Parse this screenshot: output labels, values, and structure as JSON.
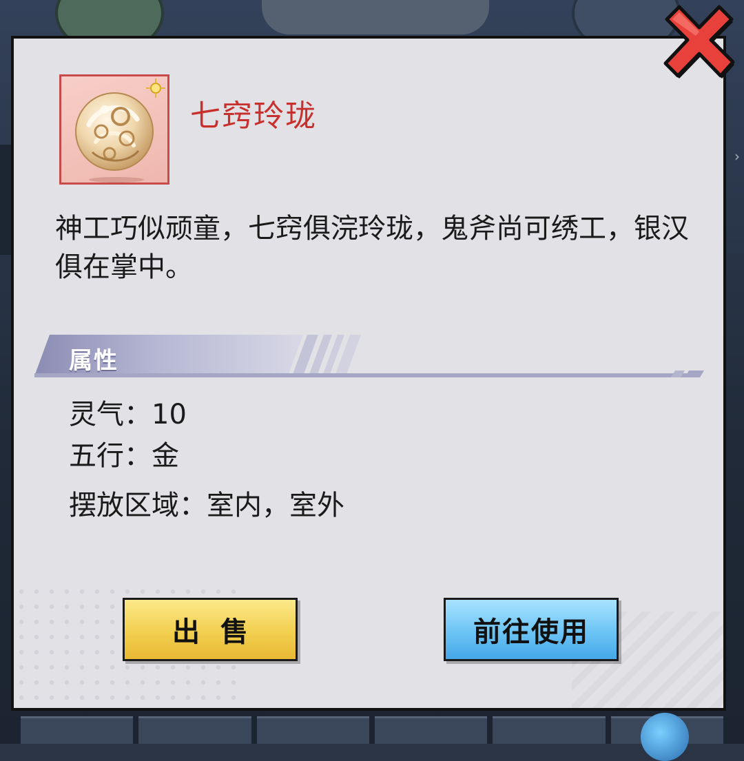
{
  "item": {
    "name": "七窍玲珑",
    "description": "神工巧似顽童，七窍俱浣玲珑，鬼斧尚可绣工，银汉俱在掌中。",
    "frame_color": "#c84a4a",
    "icon": "jade-sphere-icon"
  },
  "attributes": {
    "header": "属性",
    "rows": [
      {
        "label": "灵气",
        "separator": "：",
        "value": "10"
      },
      {
        "label": "五行",
        "separator": "：",
        "value": "金"
      },
      {
        "label": "摆放区域",
        "separator": "：",
        "value": "室内，室外"
      }
    ]
  },
  "buttons": {
    "sell_label": "出售",
    "use_label": "前往使用"
  },
  "colors": {
    "title_red": "#c8302e",
    "sell_yellow": "#f2cf4f",
    "use_blue": "#6cc4f5",
    "close_red": "#e8413c"
  }
}
